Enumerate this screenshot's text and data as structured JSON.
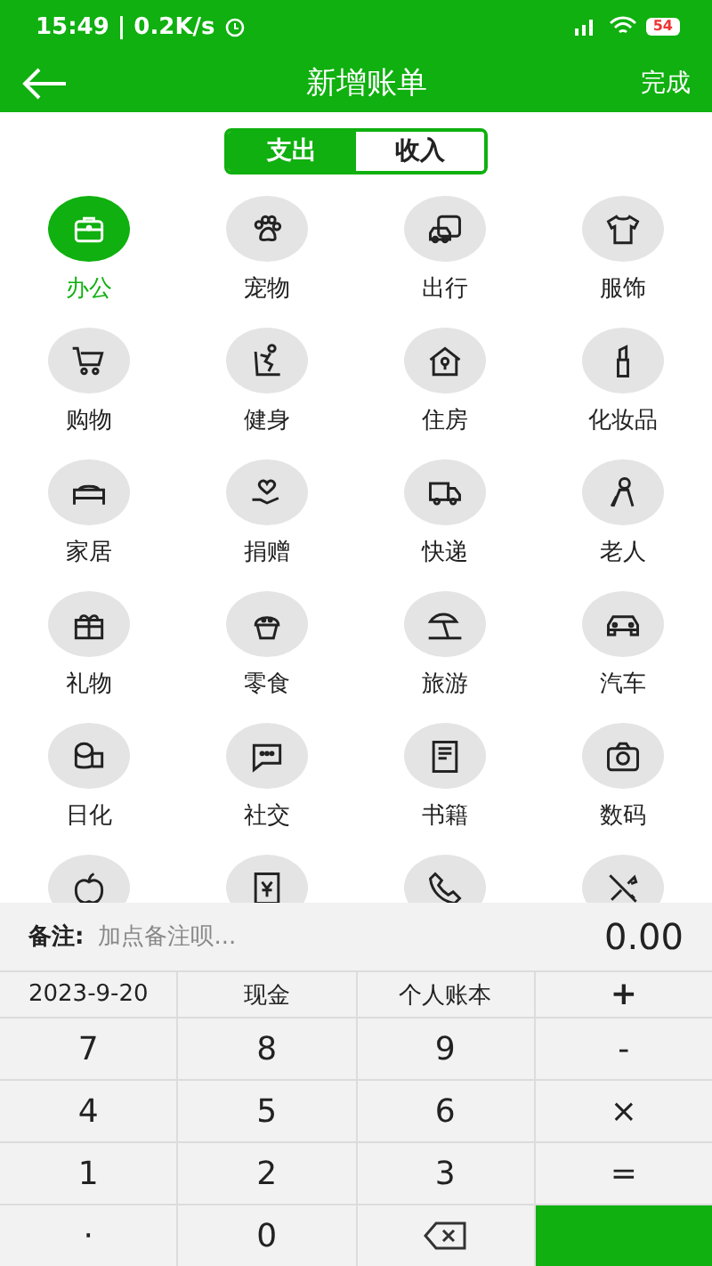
{
  "status_bar": {
    "time": "15:49 | 0.2K/s",
    "battery": "54"
  },
  "header": {
    "title": "新增账单",
    "action": "完成"
  },
  "tabs": [
    {
      "label": "支出",
      "selected": true
    },
    {
      "label": "收入",
      "selected": false
    }
  ],
  "categories": [
    {
      "label": "办公",
      "selected": true
    },
    {
      "label": "宠物",
      "selected": false
    },
    {
      "label": "出行",
      "selected": false
    },
    {
      "label": "服饰",
      "selected": false
    },
    {
      "label": "购物",
      "selected": false
    },
    {
      "label": "健身",
      "selected": false
    },
    {
      "label": "住房",
      "selected": false
    },
    {
      "label": "化妆品",
      "selected": false
    },
    {
      "label": "家居",
      "selected": false
    },
    {
      "label": "捐赠",
      "selected": false
    },
    {
      "label": "快递",
      "selected": false
    },
    {
      "label": "老人",
      "selected": false
    },
    {
      "label": "礼物",
      "selected": false
    },
    {
      "label": "零食",
      "selected": false
    },
    {
      "label": "旅游",
      "selected": false
    },
    {
      "label": "汽车",
      "selected": false
    },
    {
      "label": "日化",
      "selected": false
    },
    {
      "label": "社交",
      "selected": false
    },
    {
      "label": "书籍",
      "selected": false
    },
    {
      "label": "数码",
      "selected": false
    },
    {
      "selected": false
    },
    {
      "selected": false
    },
    {
      "selected": false
    },
    {
      "selected": false
    }
  ],
  "note": {
    "label": "备注:",
    "placeholder": "加点备注呗...",
    "amount": "0.00"
  },
  "keypad": [
    {
      "label": "2023-9-20",
      "kind": "option"
    },
    {
      "label": "现金",
      "kind": "option"
    },
    {
      "label": "个人账本",
      "kind": "option"
    },
    {
      "label": "+",
      "kind": "key"
    },
    {
      "label": "7",
      "kind": "key"
    },
    {
      "label": "8",
      "kind": "key"
    },
    {
      "label": "9",
      "kind": "key"
    },
    {
      "label": "-",
      "kind": "key"
    },
    {
      "label": "4",
      "kind": "key"
    },
    {
      "label": "5",
      "kind": "key"
    },
    {
      "label": "6",
      "kind": "key"
    },
    {
      "label": "×",
      "kind": "key"
    },
    {
      "label": "1",
      "kind": "key"
    },
    {
      "label": "2",
      "kind": "key"
    },
    {
      "label": "3",
      "kind": "key"
    },
    {
      "label": "=",
      "kind": "key"
    },
    {
      "label": "·",
      "kind": "key"
    },
    {
      "label": "0",
      "kind": "key"
    },
    {
      "kind": "backspace"
    },
    {
      "kind": "confirm"
    }
  ]
}
